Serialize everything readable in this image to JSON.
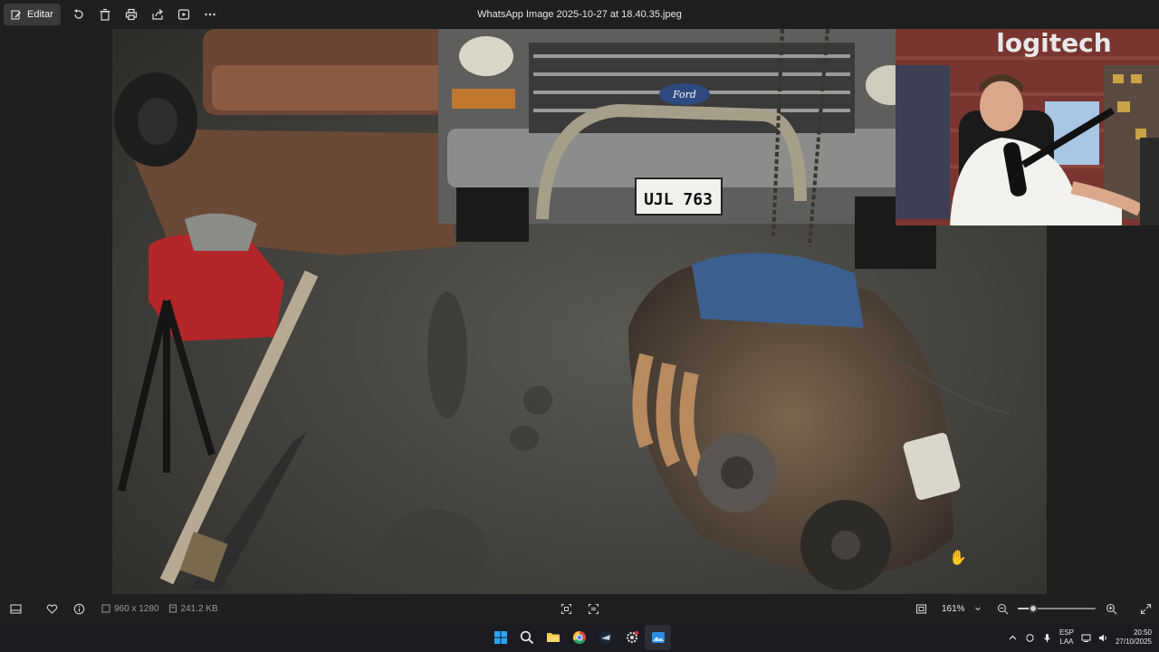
{
  "toolbar": {
    "edit_label": "Editar",
    "icons": [
      "rotate-icon",
      "delete-icon",
      "print-icon",
      "share-icon",
      "slideshow-icon",
      "more-icon"
    ]
  },
  "window": {
    "title": "WhatsApp Image 2025-10-27 at 18.40.35.jpeg"
  },
  "photo": {
    "license_plate": "UJL 763",
    "grille_badge": "Ford",
    "webcam_sign": "logitech"
  },
  "bottombar": {
    "dimensions": "960 x 1280",
    "file_size": "241.2 KB",
    "zoom_value": "161%",
    "zoom_level": 0.2
  },
  "taskbar": {
    "apps": [
      "windows-start-icon",
      "search-icon",
      "file-explorer-icon",
      "chrome-icon",
      "steam-icon",
      "gear-app-icon",
      "photos-icon"
    ],
    "lang_top": "ESP",
    "lang_bottom": "LAA",
    "time": "20:50",
    "date": "27/10/2025"
  },
  "colors": {
    "accent": "#0078d4",
    "toolbar_bg": "#1f1f1f",
    "taskbar_bg": "#1b1b22"
  }
}
